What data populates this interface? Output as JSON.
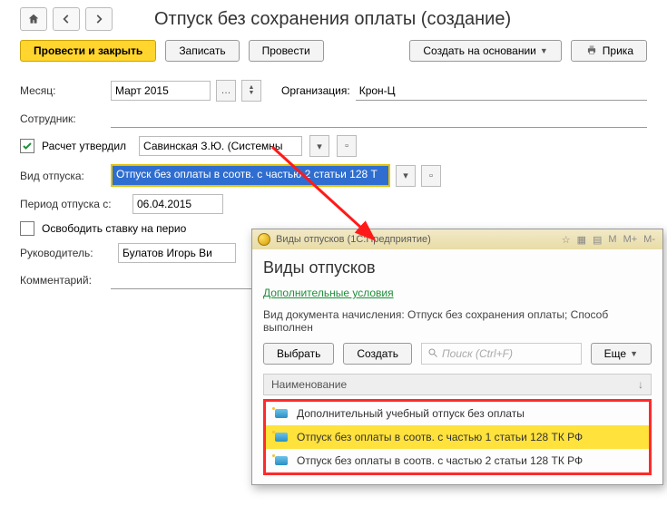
{
  "header": {
    "title": "Отпуск без сохранения оплаты (создание)"
  },
  "actions": {
    "submit_close": "Провести и закрыть",
    "save": "Записать",
    "submit": "Провести",
    "create_based": "Создать на основании",
    "print": "Прика"
  },
  "form": {
    "month_label": "Месяц:",
    "month_value": "Март 2015",
    "org_label": "Организация:",
    "org_value": "Крон-Ц",
    "employee_label": "Сотрудник:",
    "employee_value": "",
    "calc_approved_label": "Расчет утвердил",
    "approver_value": "Савинская З.Ю. (Системны",
    "leave_type_label": "Вид отпуска:",
    "leave_type_value": "Отпуск без оплаты в соотв. с частью 2 статьи 128 Т",
    "period_from_label": "Период отпуска с:",
    "period_from_value": "06.04.2015",
    "release_rate_label": "Освободить ставку на перио",
    "manager_label": "Руководитель:",
    "manager_value": "Булатов Игорь Ви",
    "comment_label": "Комментарий:",
    "comment_value": ""
  },
  "popup": {
    "window_title": "Виды отпусков   (1С:Предприятие)",
    "heading": "Виды отпусков",
    "extra_link": "Дополнительные условия",
    "doc_line": "Вид документа начисления: Отпуск без сохранения оплаты; Способ выполнен",
    "select_btn": "Выбрать",
    "create_btn": "Создать",
    "search_placeholder": "Поиск (Ctrl+F)",
    "more_btn": "Еще",
    "column_name": "Наименование",
    "rows": [
      "Дополнительный учебный отпуск без оплаты",
      "Отпуск без оплаты в соотв. с частью 1 статьи 128 ТК РФ",
      "Отпуск без оплаты в соотв. с частью 2 статьи 128 ТК РФ"
    ],
    "toolbar_m": "M",
    "toolbar_mp": "M+",
    "toolbar_mm": "M-"
  }
}
